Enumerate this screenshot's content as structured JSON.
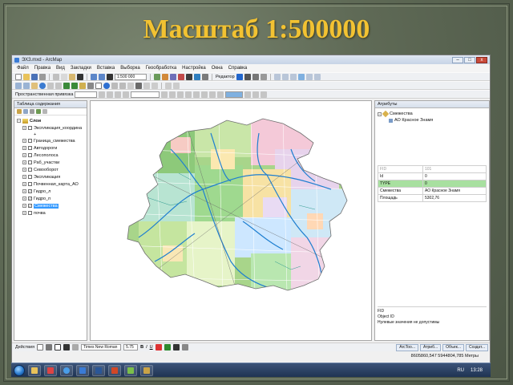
{
  "slide": {
    "title": "Масштаб 1:500000"
  },
  "window": {
    "title": "ЭХЗ.mxd - ArcMap",
    "min": "–",
    "max": "□",
    "close": "x"
  },
  "menu": [
    "Файл",
    "Правка",
    "Вид",
    "Закладки",
    "Вставка",
    "Выборка",
    "Геообработка",
    "Настройка",
    "Окна",
    "Справка"
  ],
  "toolbar": {
    "scale_value": "1:500 000",
    "editor_label": "Редактор",
    "spatial_adjust_label": "Пространственная привязка"
  },
  "toc": {
    "title": "Таблица содержания",
    "root_label": "Слои",
    "layers": [
      {
        "label": "Экспликация_координа",
        "checked": false
      },
      {
        "label": "Граница_смежества",
        "checked": false
      },
      {
        "label": "Автодороги",
        "checked": false
      },
      {
        "label": "Лесополоса",
        "checked": false
      },
      {
        "label": "Раб_участки",
        "checked": false
      },
      {
        "label": "Севооборот",
        "checked": false
      },
      {
        "label": "Экспликация",
        "checked": false
      },
      {
        "label": "Почвенная_карта_АО",
        "checked": false
      },
      {
        "label": "Гидро_л",
        "checked": true
      },
      {
        "label": "Гидро_п",
        "checked": true
      },
      {
        "label": "Смежества",
        "checked": true,
        "selected": true
      },
      {
        "label": "почва",
        "checked": false
      }
    ],
    "sub_item": "+"
  },
  "attributes": {
    "title": "Атрибуты",
    "layer": "Смежества",
    "feature": "АО Красное Знамя",
    "rows": [
      {
        "field": "FID",
        "value": "101",
        "muted": true
      },
      {
        "field": "Id",
        "value": "0"
      },
      {
        "field": "TYPE",
        "value": "0",
        "highlight": true
      },
      {
        "field": "Смежества",
        "value": "АО Красное Знамя"
      },
      {
        "field": "Площадь",
        "value": "5302,76"
      }
    ],
    "description": [
      "FID",
      "Object ID",
      "Нулевые значения не допустимы"
    ]
  },
  "draw": {
    "label": "Действия",
    "font": "Times New Roman",
    "size": "5.75",
    "bold": "B",
    "italic": "I",
    "underline": "U"
  },
  "dock_tabs": [
    "ArcToo...",
    "Атриб...",
    "Объек...",
    "Создат..."
  ],
  "status": {
    "coordinates": "8605860,547  5944804,785 Метры"
  },
  "taskbar": {
    "lang": "RU",
    "time": "13:28"
  }
}
